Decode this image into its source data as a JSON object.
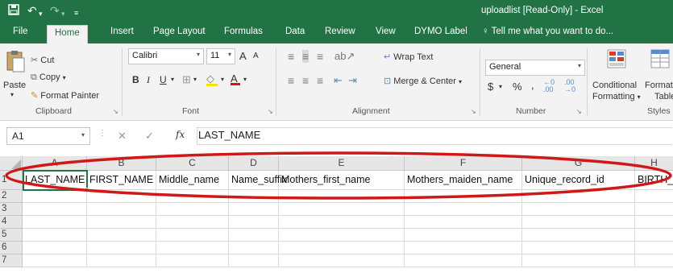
{
  "window": {
    "title": "uploadlist  [Read-Only] - Excel"
  },
  "ribbon_tabs": [
    "File",
    "Home",
    "Insert",
    "Page Layout",
    "Formulas",
    "Data",
    "Review",
    "View",
    "DYMO Label"
  ],
  "tell_me": "Tell me what you want to do...",
  "clipboard": {
    "paste": "Paste",
    "cut": "Cut",
    "copy": "Copy",
    "format_painter": "Format Painter",
    "group": "Clipboard"
  },
  "font": {
    "name": "Calibri",
    "size": "11",
    "bold": "B",
    "italic": "I",
    "underline": "U",
    "grow": "A",
    "shrink": "A",
    "group": "Font"
  },
  "alignment": {
    "wrap_text": "Wrap Text",
    "merge_center": "Merge & Center",
    "group": "Alignment"
  },
  "number": {
    "format": "General",
    "currency": "$",
    "percent": "%",
    "comma": ",",
    "inc_dec": ".00",
    "dec_dec": ".00",
    "group": "Number"
  },
  "styles": {
    "conditional": "Conditional",
    "formatting": "Formatting",
    "format_as": "Format as",
    "table": "Table",
    "group": "Styles"
  },
  "formula_bar": {
    "name_box": "A1",
    "fx": "fx",
    "value": "LAST_NAME"
  },
  "columns": [
    "A",
    "B",
    "C",
    "D",
    "E",
    "F",
    "G",
    "H"
  ],
  "rows": [
    "1",
    "2",
    "3",
    "4",
    "5",
    "6",
    "7"
  ],
  "row1": [
    "LAST_NAME",
    "FIRST_NAME",
    "Middle_name",
    "Name_suffix",
    "Mothers_first_name",
    "Mothers_maiden_name",
    "Unique_record_id",
    "BIRTH_DAT"
  ],
  "annotation": {
    "color": "#d01818",
    "shape": "ellipse around column headers and row 1"
  }
}
